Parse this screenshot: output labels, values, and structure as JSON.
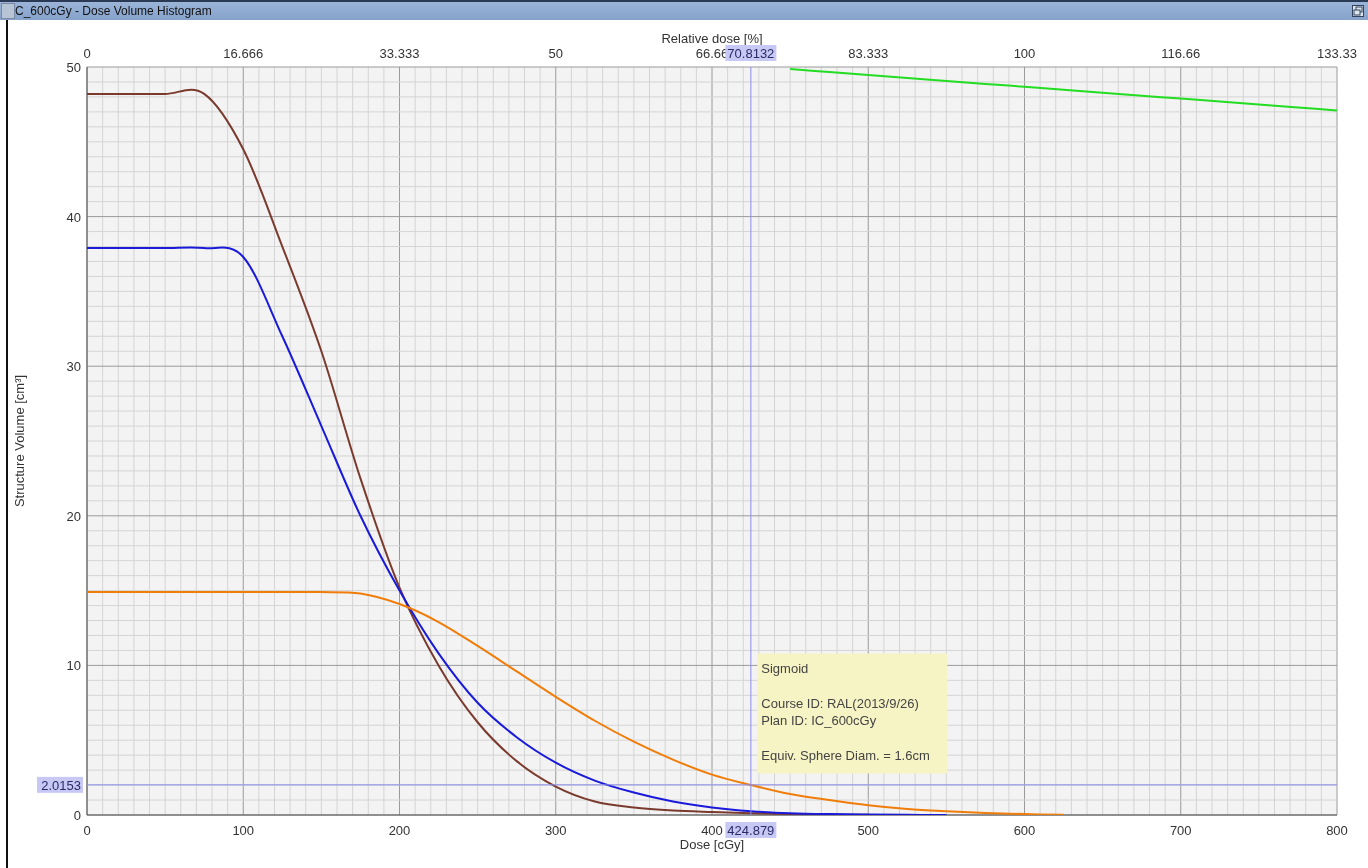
{
  "window": {
    "title": "C_600cGy - Dose Volume Histogram"
  },
  "dvh": {
    "chart_data": {
      "type": "line",
      "xlabel": "Dose [cGy]",
      "ylabel": "Structure Volume [cm³]",
      "grid": true,
      "x": [
        0,
        25,
        50,
        75,
        100,
        125,
        150,
        175,
        200,
        225,
        250,
        275,
        300,
        325,
        350,
        375,
        400,
        425,
        450,
        475,
        500,
        525,
        550,
        575,
        600,
        625,
        650,
        675,
        700,
        725,
        750,
        775,
        800
      ],
      "series": [
        {
          "color": "#7a3b2e",
          "values": [
            48.2,
            48.2,
            48.2,
            48.2,
            44.5,
            38,
            31,
            22.5,
            15.2,
            10,
            6.2,
            3.6,
            1.9,
            0.9,
            0.5,
            0.3,
            0.2,
            0.12,
            0.06,
            0.03,
            0.01,
            null,
            null,
            null,
            null,
            null,
            null,
            null,
            null,
            null,
            null,
            null,
            null
          ]
        },
        {
          "color": "#1a1adb",
          "values": [
            37.9,
            37.9,
            37.9,
            37.9,
            37.3,
            32,
            26,
            20,
            15,
            10.8,
            7.5,
            5.2,
            3.5,
            2.3,
            1.5,
            0.9,
            0.5,
            0.25,
            0.12,
            0.06,
            0.03,
            0.01,
            0,
            null,
            null,
            null,
            null,
            null,
            null,
            null,
            null,
            null,
            null
          ]
        },
        {
          "color": "#f07d0a",
          "values": [
            14.9,
            14.9,
            14.9,
            14.9,
            14.9,
            14.9,
            14.9,
            14.8,
            14.1,
            12.9,
            11.3,
            9.6,
            7.9,
            6.3,
            4.9,
            3.7,
            2.7,
            2.0,
            1.4,
            1.0,
            0.65,
            0.4,
            0.25,
            0.14,
            0.06,
            0.01,
            null,
            null,
            null,
            null,
            null,
            null,
            null
          ]
        },
        {
          "color": "#22dd22",
          "values": [
            null,
            null,
            null,
            null,
            null,
            null,
            null,
            null,
            null,
            null,
            null,
            null,
            null,
            null,
            null,
            null,
            null,
            null,
            49.86,
            49.66,
            49.47,
            49.27,
            49.07,
            48.87,
            48.68,
            48.48,
            48.28,
            48.08,
            47.89,
            47.69,
            47.49,
            47.29,
            47.1
          ]
        }
      ],
      "xlim": [
        0,
        800
      ],
      "ylim": [
        0,
        50
      ],
      "xticks": [
        0,
        100,
        200,
        300,
        400,
        500,
        600,
        700,
        800
      ],
      "yticks": [
        0,
        10,
        20,
        30,
        40,
        50
      ],
      "ref_lines": [
        {
          "axis": "x",
          "value": 424.879,
          "label": "424.879"
        },
        {
          "axis": "y",
          "value": 2.0153,
          "label": "2.0153"
        }
      ]
    },
    "relative_axis": {
      "label": "Relative dose [%]",
      "ticks": [
        "0",
        "16.666",
        "33.333",
        "50",
        "66.66",
        "83.333",
        "100",
        "116.66",
        "133.33"
      ],
      "cursor_label": "70.8132"
    },
    "tooltip": {
      "groups": [
        [
          "Sigmoid"
        ],
        [
          "Course ID: RAL(2013/9/26)",
          "Plan ID: IC_600cGy"
        ],
        [
          "Equiv. Sphere Diam. = 1.6cm"
        ]
      ]
    }
  }
}
